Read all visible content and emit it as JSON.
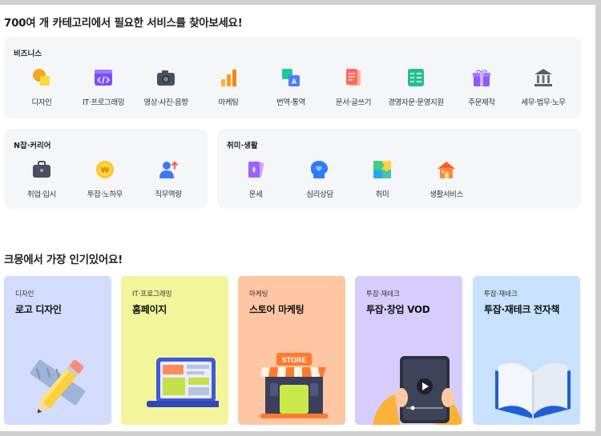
{
  "page": {
    "title": "700여 개 카테고리에서 필요한 서비스를 찾아보세요!",
    "popular_title": "크몽에서 가장 인기있어요!"
  },
  "business": {
    "title": "비즈니스",
    "items": [
      {
        "label": "디자인",
        "icon": "design-icon"
      },
      {
        "label": "IT·프로그래밍",
        "icon": "code-icon"
      },
      {
        "label": "영상·사진·음향",
        "icon": "camera-icon"
      },
      {
        "label": "마케팅",
        "icon": "bar-chart-icon"
      },
      {
        "label": "번역·통역",
        "icon": "translate-icon"
      },
      {
        "label": "문서·글쓰기",
        "icon": "document-icon"
      },
      {
        "label": "경영자문·운영지원",
        "icon": "spreadsheet-icon"
      },
      {
        "label": "주문제작",
        "icon": "gift-icon"
      },
      {
        "label": "세무·법무·노무",
        "icon": "bank-icon"
      }
    ]
  },
  "career": {
    "title": "N잡·커리어",
    "items": [
      {
        "label": "취업·입시",
        "icon": "briefcase-icon"
      },
      {
        "label": "투잡·노하우",
        "icon": "won-coin-icon"
      },
      {
        "label": "직무역량",
        "icon": "person-growth-icon"
      }
    ]
  },
  "hobby": {
    "title": "취미·생활",
    "items": [
      {
        "label": "운세",
        "icon": "tarot-card-icon"
      },
      {
        "label": "심리상담",
        "icon": "head-heart-icon"
      },
      {
        "label": "취미",
        "icon": "puzzle-icon"
      },
      {
        "label": "생활서비스",
        "icon": "house-icon"
      }
    ]
  },
  "popular": [
    {
      "category": "디자인",
      "title": "로고 디자인",
      "bg": "#d3dcfd",
      "art": "pencil-ruler-icon"
    },
    {
      "category": "IT·프로그래밍",
      "title": "홈페이지",
      "bg": "#f2f59a",
      "art": "laptop-icon"
    },
    {
      "category": "마케팅",
      "title": "스토어 마케팅",
      "bg": "#fec6a2",
      "art": "store-icon"
    },
    {
      "category": "투잡·재테크",
      "title": "투잡·창업 VOD",
      "bg": "#d6cdfc",
      "art": "tablet-video-icon"
    },
    {
      "category": "투잡·재테크",
      "title": "투잡·재테크 전자책",
      "bg": "#c8e2fd",
      "art": "open-book-icon"
    }
  ],
  "store_sign": "STORE"
}
